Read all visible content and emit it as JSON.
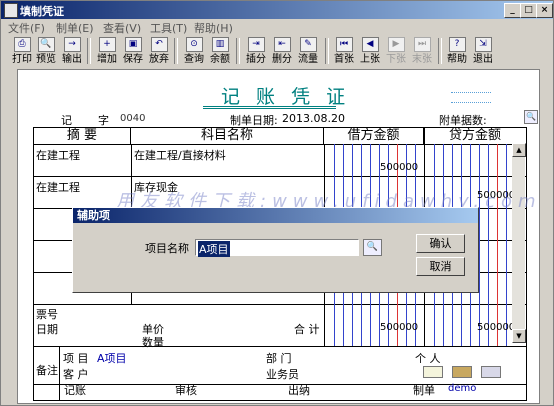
{
  "window": {
    "title": "填制凭证",
    "min": "_",
    "max": "□",
    "close": "×"
  },
  "menu": [
    {
      "label": "文件(F)"
    },
    {
      "label": "制单(E)"
    },
    {
      "label": "查看(V)"
    },
    {
      "label": "工具(T)"
    },
    {
      "label": "帮助(H)"
    }
  ],
  "toolbar": [
    {
      "label": "打印",
      "icon": "print-icon",
      "glyph": "⎙"
    },
    {
      "label": "预览",
      "icon": "preview-icon",
      "glyph": "🔍"
    },
    {
      "label": "输出",
      "icon": "export-icon",
      "glyph": "→"
    },
    {
      "label": "增加",
      "icon": "add-icon",
      "glyph": "+"
    },
    {
      "label": "保存",
      "icon": "save-icon",
      "glyph": "▣"
    },
    {
      "label": "放弃",
      "icon": "undo-icon",
      "glyph": "↶"
    },
    {
      "label": "查询",
      "icon": "binoculars-icon",
      "glyph": "⊙"
    },
    {
      "label": "余额",
      "icon": "balance-chart-icon",
      "glyph": "▥"
    },
    {
      "label": "插分",
      "icon": "insert-row-icon",
      "glyph": "⇥"
    },
    {
      "label": "删分",
      "icon": "delete-row-icon",
      "glyph": "⇤"
    },
    {
      "label": "流量",
      "icon": "cashflow-icon",
      "glyph": "✎"
    },
    {
      "label": "首张",
      "icon": "first-icon",
      "glyph": "⏮"
    },
    {
      "label": "上张",
      "icon": "previous-icon",
      "glyph": "◀"
    },
    {
      "label": "下张",
      "icon": "next-icon",
      "glyph": "▶"
    },
    {
      "label": "末张",
      "icon": "last-icon",
      "glyph": "⏭"
    },
    {
      "label": "帮助",
      "icon": "help-icon",
      "glyph": "?"
    },
    {
      "label": "退出",
      "icon": "exit-icon",
      "glyph": "⇲"
    }
  ],
  "voucher": {
    "title": "记 账 凭 证",
    "type_label": "记",
    "number_label": "字",
    "number": "0040",
    "date_label": "制单日期:",
    "date": "2013.08.20",
    "attachment_label": "附单据数:",
    "headers": {
      "summary": "摘 要",
      "account": "科目名称",
      "debit": "借方金额",
      "credit": "贷方金额"
    },
    "rows": [
      {
        "summary": "在建工程",
        "account": "在建工程/直接材料",
        "debit": "500000",
        "credit": ""
      },
      {
        "summary": "在建工程",
        "account": "库存现金",
        "debit": "",
        "credit": "500000"
      }
    ],
    "footer": {
      "bill_no": "票号",
      "date": "日期",
      "unit_price": "单价",
      "quantity": "数量",
      "total_label": "合 计",
      "total_debit": "500000",
      "total_credit": "500000",
      "remark": "备注",
      "project_label": "项  目",
      "project_value": "A项目",
      "customer_label": "客  户",
      "department_label": "部  门",
      "person_label": "个  人",
      "salesperson_label": "业务员"
    },
    "sign": {
      "bookkeeper": "记账",
      "auditor": "审核",
      "cashier": "出纳",
      "maker_label": "制单",
      "maker": "demo"
    }
  },
  "dialog": {
    "title": "辅助项",
    "field_label": "项目名称",
    "field_value": "A项目",
    "ok": "确认",
    "cancel": "取消"
  },
  "watermark": "用友软件下载:www.ufidawhy.com"
}
